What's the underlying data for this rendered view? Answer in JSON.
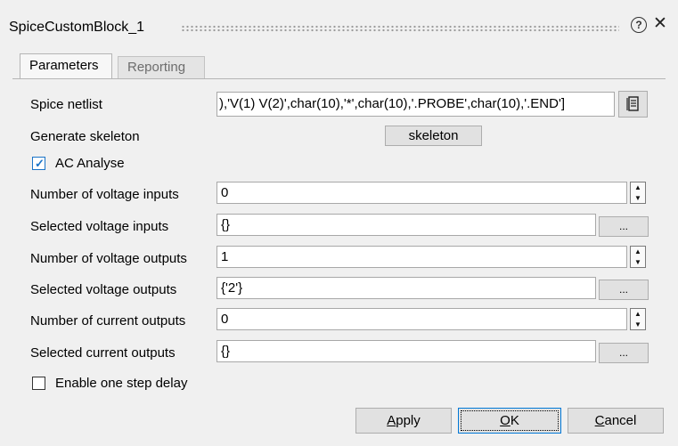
{
  "window": {
    "title": "SpiceCustomBlock_1",
    "help_glyph": "?",
    "close_glyph": "✕"
  },
  "tabs": [
    {
      "label": "Parameters",
      "active": true
    },
    {
      "label": "Reporting",
      "active": false
    }
  ],
  "params": {
    "spice_netlist": {
      "label": "Spice netlist",
      "value": "),'V(1) V(2)',char(10),'*',char(10),'.PROBE',char(10),'.END']"
    },
    "generate_skeleton": {
      "label": "Generate skeleton",
      "button": "skeleton"
    },
    "ac_analyse": {
      "label": "AC Analyse",
      "checked": true
    },
    "num_voltage_inputs": {
      "label": "Number of voltage inputs",
      "value": "0"
    },
    "sel_voltage_inputs": {
      "label": "Selected voltage inputs",
      "value": "{}",
      "button": "..."
    },
    "num_voltage_outputs": {
      "label": "Number of voltage outputs",
      "value": "1"
    },
    "sel_voltage_outputs": {
      "label": "Selected voltage outputs",
      "value": "{'2'}",
      "button": "..."
    },
    "num_current_outputs": {
      "label": "Number of current outputs",
      "value": "0"
    },
    "sel_current_outputs": {
      "label": "Selected current outputs",
      "value": "{}",
      "button": "..."
    },
    "one_step_delay": {
      "label": "Enable one step delay",
      "checked": false
    }
  },
  "buttons": {
    "apply": {
      "mnemonic": "A",
      "rest": "pply"
    },
    "ok": {
      "mnemonic": "O",
      "rest": "K"
    },
    "cancel": {
      "mnemonic": "C",
      "rest": "ancel"
    }
  },
  "icons": {
    "editor": "document-editor-icon",
    "check": "checkmark-icon",
    "spin_up": "▲",
    "spin_down": "▼"
  },
  "colors": {
    "accent": "#1a73c7",
    "background": "#f0f0f0"
  }
}
